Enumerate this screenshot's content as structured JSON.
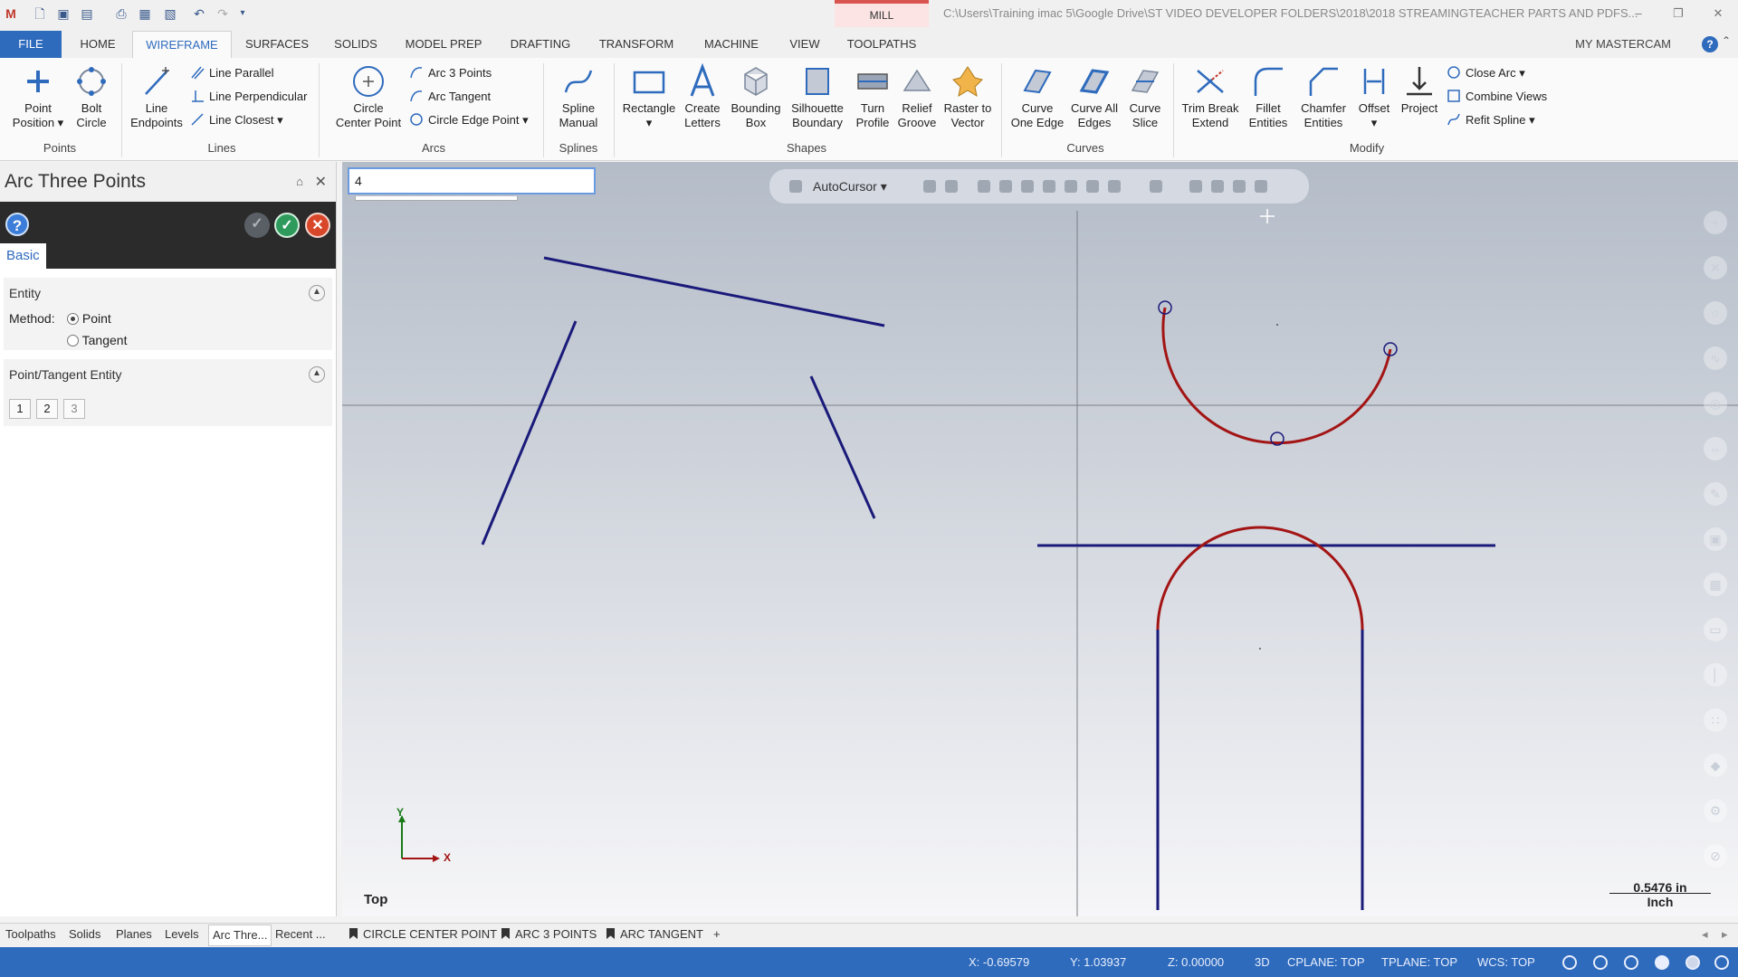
{
  "window": {
    "context_tab": "MILL",
    "path": "C:\\Users\\Training imac 5\\Google Drive\\ST VIDEO DEVELOPER FOLDERS\\2018\\2018 STREAMINGTEACHER PARTS AND PDFS..."
  },
  "ribbon_tabs": [
    "FILE",
    "HOME",
    "WIREFRAME",
    "SURFACES",
    "SOLIDS",
    "MODEL PREP",
    "DRAFTING",
    "TRANSFORM",
    "MACHINE",
    "VIEW",
    "TOOLPATHS"
  ],
  "active_tab": "WIREFRAME",
  "my_mastercam": "MY MASTERCAM",
  "ribbon": {
    "points": {
      "point_position": "Point\nPosition",
      "bolt_circle": "Bolt\nCircle",
      "group": "Points"
    },
    "lines": {
      "line_endpoints": "Line\nEndpoints",
      "line_parallel": "Line Parallel",
      "line_perpendicular": "Line Perpendicular",
      "line_closest": "Line Closest",
      "group": "Lines"
    },
    "arcs": {
      "circle_center_point": "Circle\nCenter Point",
      "arc_3_points": "Arc 3 Points",
      "arc_tangent": "Arc Tangent",
      "circle_edge_point": "Circle Edge Point",
      "group": "Arcs"
    },
    "splines": {
      "spline_manual": "Spline\nManual",
      "group": "Splines"
    },
    "shapes": {
      "rectangle": "Rectangle",
      "create_letters": "Create\nLetters",
      "bounding_box": "Bounding\nBox",
      "silhouette_boundary": "Silhouette\nBoundary",
      "turn_profile": "Turn\nProfile",
      "relief_groove": "Relief\nGroove",
      "raster_to_vector": "Raster to\nVector",
      "group": "Shapes"
    },
    "curves": {
      "curve_one_edge": "Curve\nOne Edge",
      "curve_all_edges": "Curve All\nEdges",
      "curve_slice": "Curve\nSlice",
      "group": "Curves"
    },
    "modify": {
      "trim_break_extend": "Trim Break\nExtend",
      "fillet_entities": "Fillet\nEntities",
      "chamfer_entities": "Chamfer\nEntities",
      "offset": "Offset",
      "project": "Project",
      "close_arc": "Close Arc",
      "combine_views": "Combine Views",
      "refit_spline": "Refit Spline",
      "group": "Modify"
    }
  },
  "panel": {
    "title": "Arc Three Points",
    "tab": "Basic",
    "entity_section": "Entity",
    "method_label": "Method:",
    "method_options": [
      "Point",
      "Tangent"
    ],
    "method_selected": "Point",
    "point_section": "Point/Tangent Entity",
    "point_buttons": [
      "1",
      "2",
      "3"
    ]
  },
  "viewport": {
    "command_input": "4",
    "autocursor": "AutoCursor",
    "view_name": "Top",
    "scale_value": "0.5476 in",
    "scale_unit": "Inch",
    "axis_x": "X",
    "axis_y": "Y",
    "colors": {
      "line": "#1a1a7a",
      "arc": "#a31515"
    }
  },
  "bottom_tabs": [
    "Toolpaths",
    "Solids",
    "Planes",
    "Levels",
    "Arc Thre...",
    "Recent ..."
  ],
  "bottom_tab_active": "Arc Thre...",
  "mru_tabs": [
    "CIRCLE CENTER POINT",
    "ARC 3 POINTS",
    "ARC TANGENT"
  ],
  "mru_add": "+",
  "status": {
    "x": "X:   -0.69579",
    "y": "Y:   1.03937",
    "z": "Z:   0.00000",
    "mode": "3D",
    "cplane": "CPLANE: TOP",
    "tplane": "TPLANE: TOP",
    "wcs": "WCS: TOP"
  }
}
